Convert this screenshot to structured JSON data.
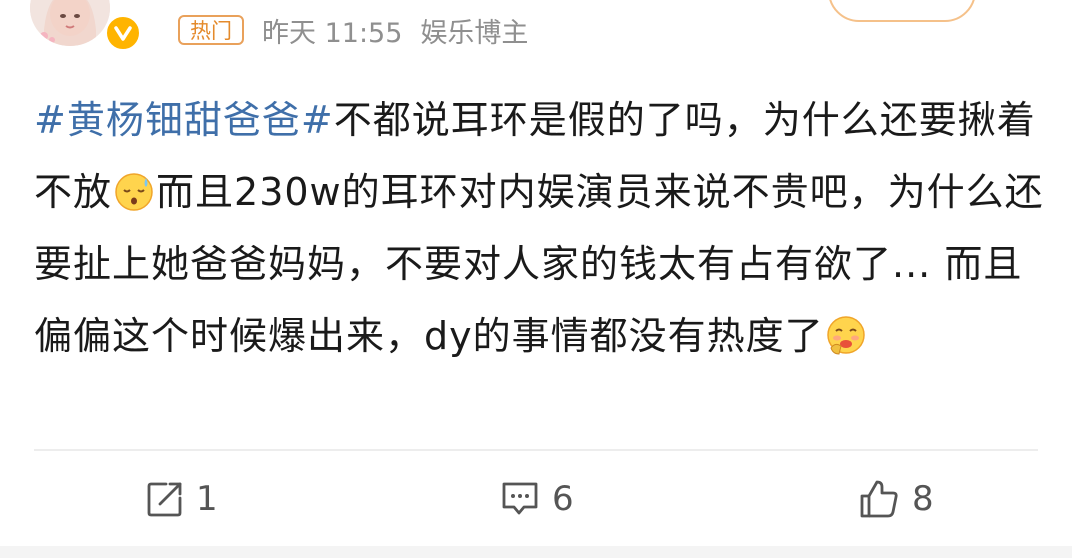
{
  "header": {
    "tag": "热门",
    "time": "昨天 11:55",
    "source": "娱乐博主"
  },
  "post": {
    "topic": "#黄杨钿甜爸爸#",
    "segments": [
      "不都说耳环是假的了吗，为什么还要揪着不放",
      "而且230w的耳环对内娱演员来说不贵吧，为什么还要扯上她爸爸妈妈，不要对人家的钱太有占有欲了... 而且偏偏这个时候爆出来，dy的事情都没有热度了"
    ],
    "emojis": [
      "sweat-face-emoji",
      "drooling-face-emoji"
    ]
  },
  "actions": {
    "repost_count": "1",
    "comment_count": "6",
    "like_count": "8"
  },
  "colors": {
    "topic": "#3f6fa9",
    "hot_tag": "#e48a2b",
    "meta": "#8f8f8f",
    "badge": "#ffb400"
  }
}
